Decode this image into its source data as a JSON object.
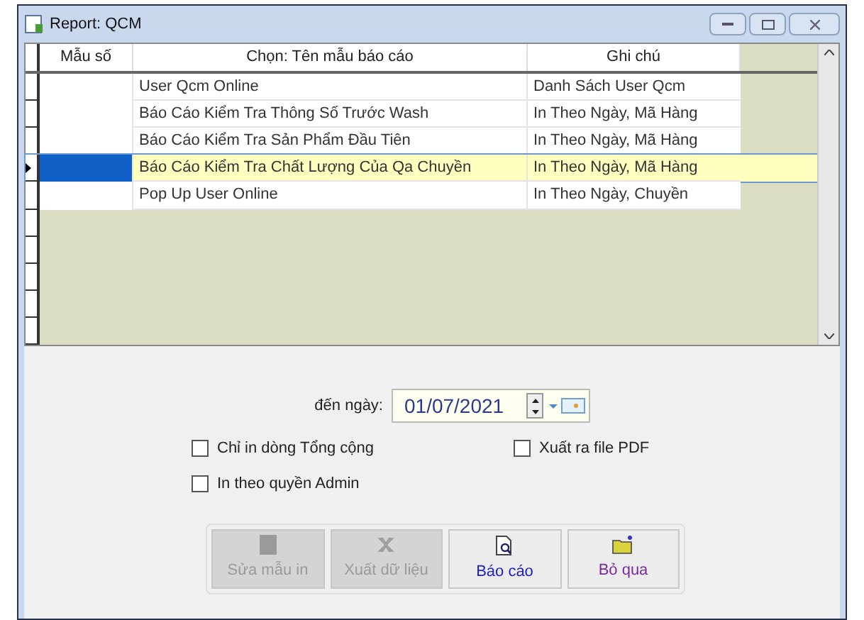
{
  "window": {
    "title": "Report: QCM"
  },
  "table": {
    "columns": [
      "Mẫu số",
      "Chọn: Tên mẫu báo cáo",
      "Ghi chú"
    ],
    "rows": [
      {
        "number": "",
        "name": "User Qcm Online",
        "note": "Danh Sách User Qcm",
        "selected": false
      },
      {
        "number": "",
        "name": "Báo Cáo Kiểm Tra Thông Số Trước Wash",
        "note": "In Theo Ngày, Mã Hàng",
        "selected": false
      },
      {
        "number": "",
        "name": "Báo Cáo Kiểm Tra Sản Phẩm Đầu Tiên",
        "note": "In Theo Ngày, Mã Hàng",
        "selected": false
      },
      {
        "number": "",
        "name": "Báo Cáo Kiểm Tra Chất Lượng Của Qa Chuyền",
        "note": "In Theo Ngày, Mã Hàng",
        "selected": true
      },
      {
        "number": "",
        "name": "Pop Up User Online",
        "note": "In Theo Ngày, Chuyền",
        "selected": false
      }
    ]
  },
  "date": {
    "label": "đến ngày:",
    "value": "01/07/2021"
  },
  "checkboxes": [
    {
      "label": "Chỉ in dòng Tổng cộng",
      "checked": false
    },
    {
      "label": "Xuất ra file PDF",
      "checked": false
    },
    {
      "label": "In theo quyền Admin",
      "checked": false
    }
  ],
  "buttons": [
    {
      "label": "Sửa mẫu in",
      "kind": "edit",
      "disabled": true
    },
    {
      "label": "Xuất dữ liệu",
      "kind": "export",
      "disabled": true
    },
    {
      "label": "Báo cáo",
      "kind": "report",
      "disabled": false
    },
    {
      "label": "Bỏ qua",
      "kind": "skip",
      "disabled": false
    }
  ]
}
